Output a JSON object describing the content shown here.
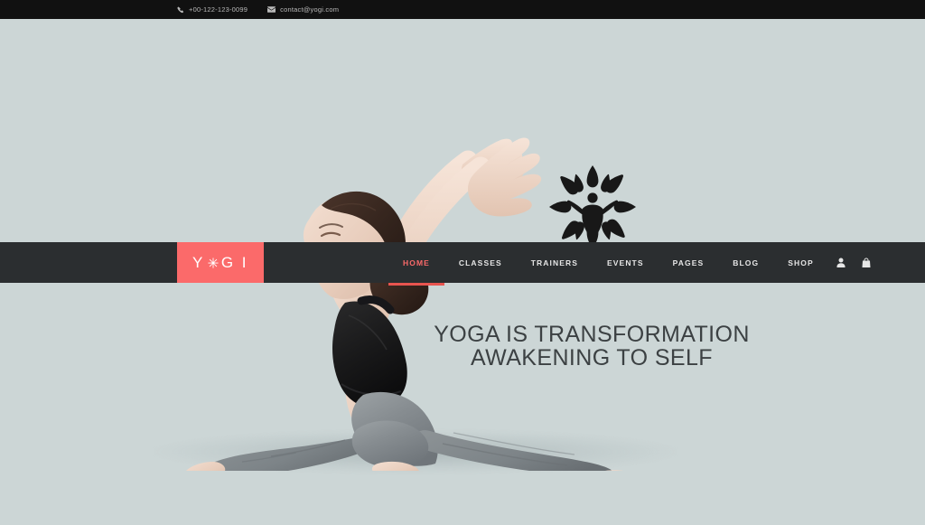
{
  "topbar": {
    "phone": "+00-122-123-0099",
    "email": "contact@yogi.com",
    "phone_icon": "phone-icon",
    "email_icon": "envelope-icon",
    "background_color": "#111111",
    "text_color": "#b9b9b9"
  },
  "logo": {
    "text_before": "Y",
    "text_after": "G I",
    "mark_icon": "lotus-flower-icon",
    "full_text": "YOGI",
    "background_color": "#fb6a6a",
    "text_color": "#ffffff"
  },
  "nav": {
    "background_color": "#2b2e30",
    "active_color": "#fb6a6a",
    "underline_color": "#e8544f",
    "items": [
      {
        "label": "HOME",
        "active": true
      },
      {
        "label": "CLASSES",
        "active": false
      },
      {
        "label": "TRAINERS",
        "active": false
      },
      {
        "label": "EVENTS",
        "active": false
      },
      {
        "label": "PAGES",
        "active": false
      },
      {
        "label": "BLOG",
        "active": false
      },
      {
        "label": "SHOP",
        "active": false
      }
    ],
    "icons": [
      {
        "name": "user-account-icon"
      },
      {
        "name": "shopping-bag-icon"
      }
    ]
  },
  "hero": {
    "background_color": "#ccd6d6",
    "emblem_icon": "yoga-figure-lotus-emblem",
    "headline_line1": "YOGA IS TRANSFORMATION",
    "headline_line2": "AWAKENING TO SELF",
    "headline_color": "#3c4143",
    "model_image": "woman-in-front-splits-yoga-pose"
  }
}
